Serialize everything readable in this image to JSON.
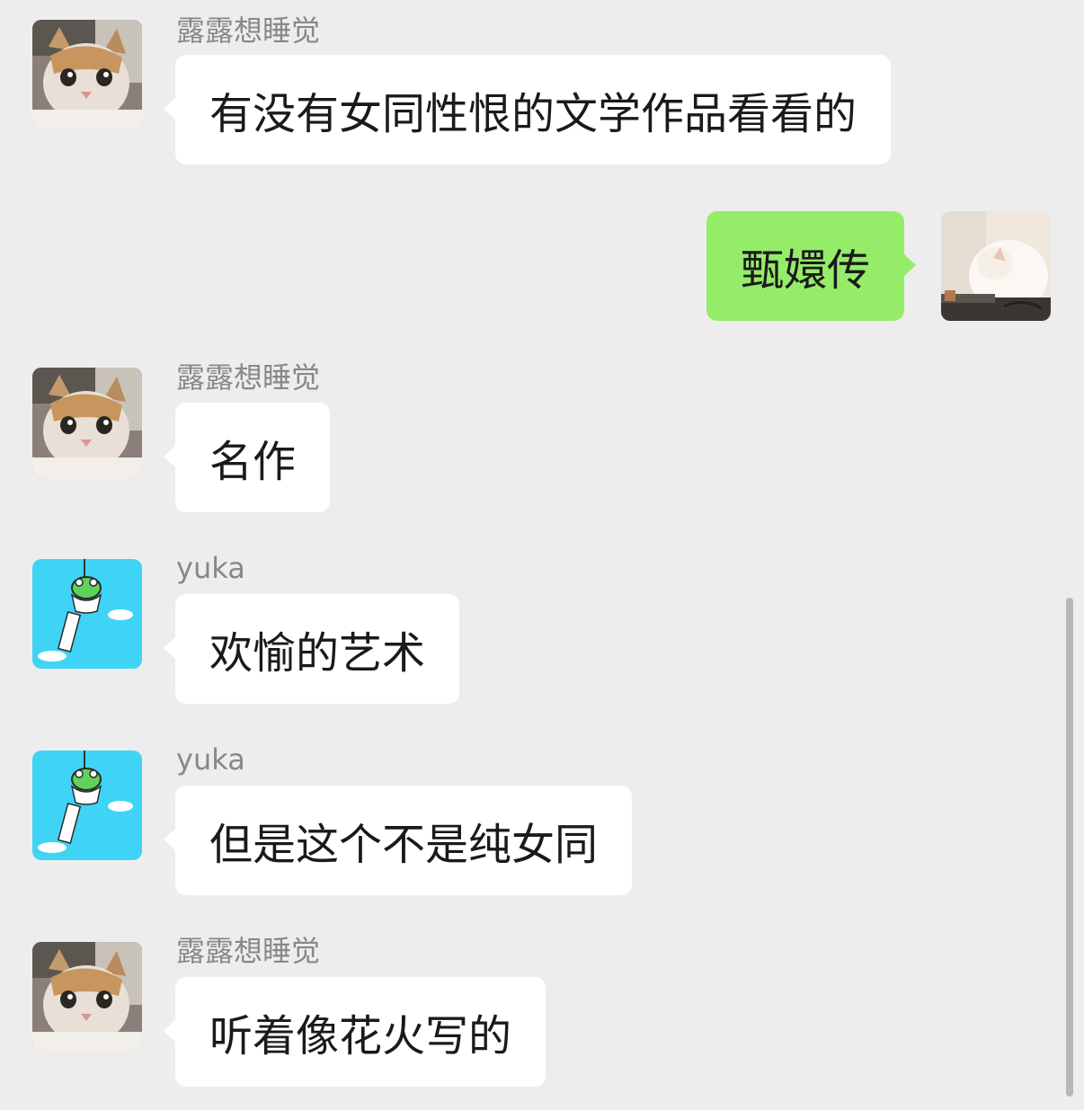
{
  "messages": [
    {
      "sender": "露露想睡觉",
      "text": "有没有女同性恨的文学作品看看的",
      "direction": "incoming",
      "avatar": "cat-avatar-icon"
    },
    {
      "sender": "",
      "text": "甄嬛传",
      "direction": "outgoing",
      "avatar": "white-cat-avatar-icon"
    },
    {
      "sender": "露露想睡觉",
      "text": "名作",
      "direction": "incoming",
      "avatar": "cat-avatar-icon"
    },
    {
      "sender": "yuka",
      "text": "欢愉的艺术",
      "direction": "incoming",
      "avatar": "frog-windchime-avatar-icon"
    },
    {
      "sender": "yuka",
      "text": "但是这个不是纯女同",
      "direction": "incoming",
      "avatar": "frog-windchime-avatar-icon"
    },
    {
      "sender": "露露想睡觉",
      "text": "听着像花火写的",
      "direction": "incoming",
      "avatar": "cat-avatar-icon"
    }
  ],
  "colors": {
    "background": "#ededed",
    "incoming_bubble": "#ffffff",
    "outgoing_bubble": "#95ec69",
    "sender_name": "#888888",
    "frog_avatar_bg": "#3fd4f6"
  }
}
